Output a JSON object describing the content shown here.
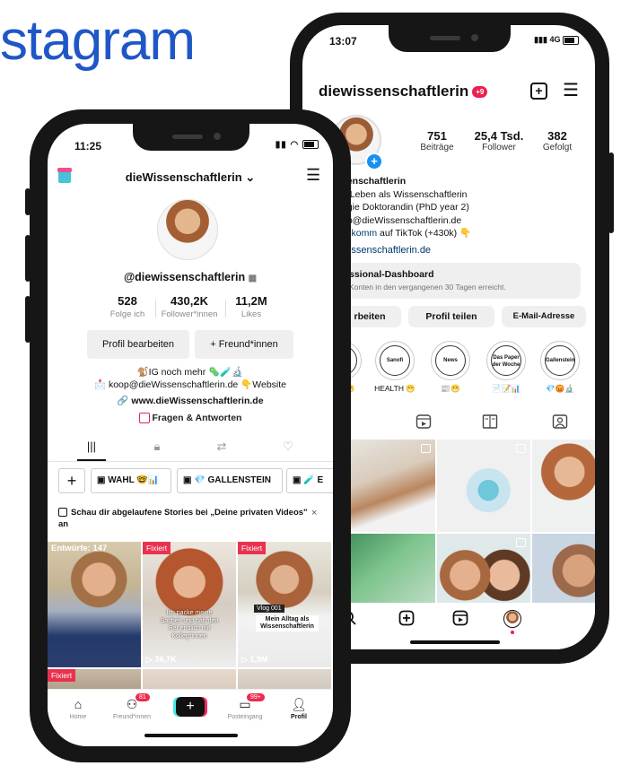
{
  "brand": {
    "text": "stagram"
  },
  "instagram": {
    "time": "13:07",
    "network": "4G",
    "username": "diewissenschaftlerin",
    "notification_badge": "+9",
    "stats": [
      {
        "value": "751",
        "label": "Beiträge"
      },
      {
        "value": "25,4 Tsd.",
        "label": "Follower"
      },
      {
        "value": "382",
        "label": "Gefolgt"
      }
    ],
    "bio": {
      "name": "senschaftlerin",
      "line1": "n Leben als Wissenschaftlerin",
      "line2": "ogie Doktorandin (PhD year 2)",
      "line3": "op@dieWissenschaftlerin.de",
      "line4_link": "sskomm",
      "line4_rest": " auf TikTok (+430k) 👇"
    },
    "website": "wissenschaftlerin.de",
    "dashboard": {
      "title": "ssional-Dashboard",
      "subtitle": "Konten in den vergangenen 30 Tagen erreicht."
    },
    "buttons": {
      "edit": "rbeiten",
      "share": "Profil teilen",
      "email": "E-Mail-Adresse"
    },
    "highlights": [
      {
        "cover": "",
        "label": "😁"
      },
      {
        "cover": "Sanofi",
        "label": "HEALTH 😁"
      },
      {
        "cover": "News",
        "label": "📰😁"
      },
      {
        "cover": "Das Paper der Woche",
        "label": "📄📝📊"
      },
      {
        "cover": "Gallenstein",
        "label": "💎😡🔬"
      }
    ]
  },
  "tiktok": {
    "time": "11:25",
    "title": "dieWissenschaftlerin",
    "handle": "@diewissenschaftlerin",
    "stats": [
      {
        "value": "528",
        "label": "Folge ich"
      },
      {
        "value": "430,2K",
        "label": "Follower*innen"
      },
      {
        "value": "11,2M",
        "label": "Likes"
      }
    ],
    "buttons": {
      "edit": "Profil bearbeiten",
      "friend": "+ Freund*innen"
    },
    "bio_line1": "🐒IG noch mehr 🦠🧪🔬",
    "bio_line2": "📩 koop@dieWissenschaftlerin.de 👇Website",
    "website": "www.dieWissenschaftlerin.de",
    "qa": "Fragen & Antworten",
    "playlists": [
      {
        "label": "WAHL 🤓📊"
      },
      {
        "label": "💎 GALLENSTEIN"
      },
      {
        "label": "🧪 E"
      }
    ],
    "notice": "Schau dir abgelaufene Stories bei „Deine privaten Videos\" an",
    "notice_close": "×",
    "videos": [
      {
        "badge": "",
        "overlay": "Entwürfe: 147",
        "views": ""
      },
      {
        "badge": "Fixiert",
        "overlay": "Ich packe meine Sachen und hab den Rat endlich mit Kolleg*innen",
        "views": "36,7K"
      },
      {
        "badge": "Fixiert",
        "overlay": "Mein Alltag als Wissenschaftlerin",
        "vlog": "Vlog 001",
        "views": "1,9M"
      },
      {
        "badge": "Fixiert",
        "overlay": "",
        "views": ""
      }
    ],
    "nav": [
      {
        "label": "Home",
        "badge": ""
      },
      {
        "label": "Freund*innen",
        "badge": "81"
      },
      {
        "label": "",
        "badge": ""
      },
      {
        "label": "Posteingang",
        "badge": "99+"
      },
      {
        "label": "Profil",
        "badge": ""
      }
    ]
  },
  "colors": {
    "brand_blue": "#1f57c7",
    "tiktok_red": "#e9324e",
    "instagram_badge": "#ed1f50",
    "link_blue": "#00376b"
  }
}
